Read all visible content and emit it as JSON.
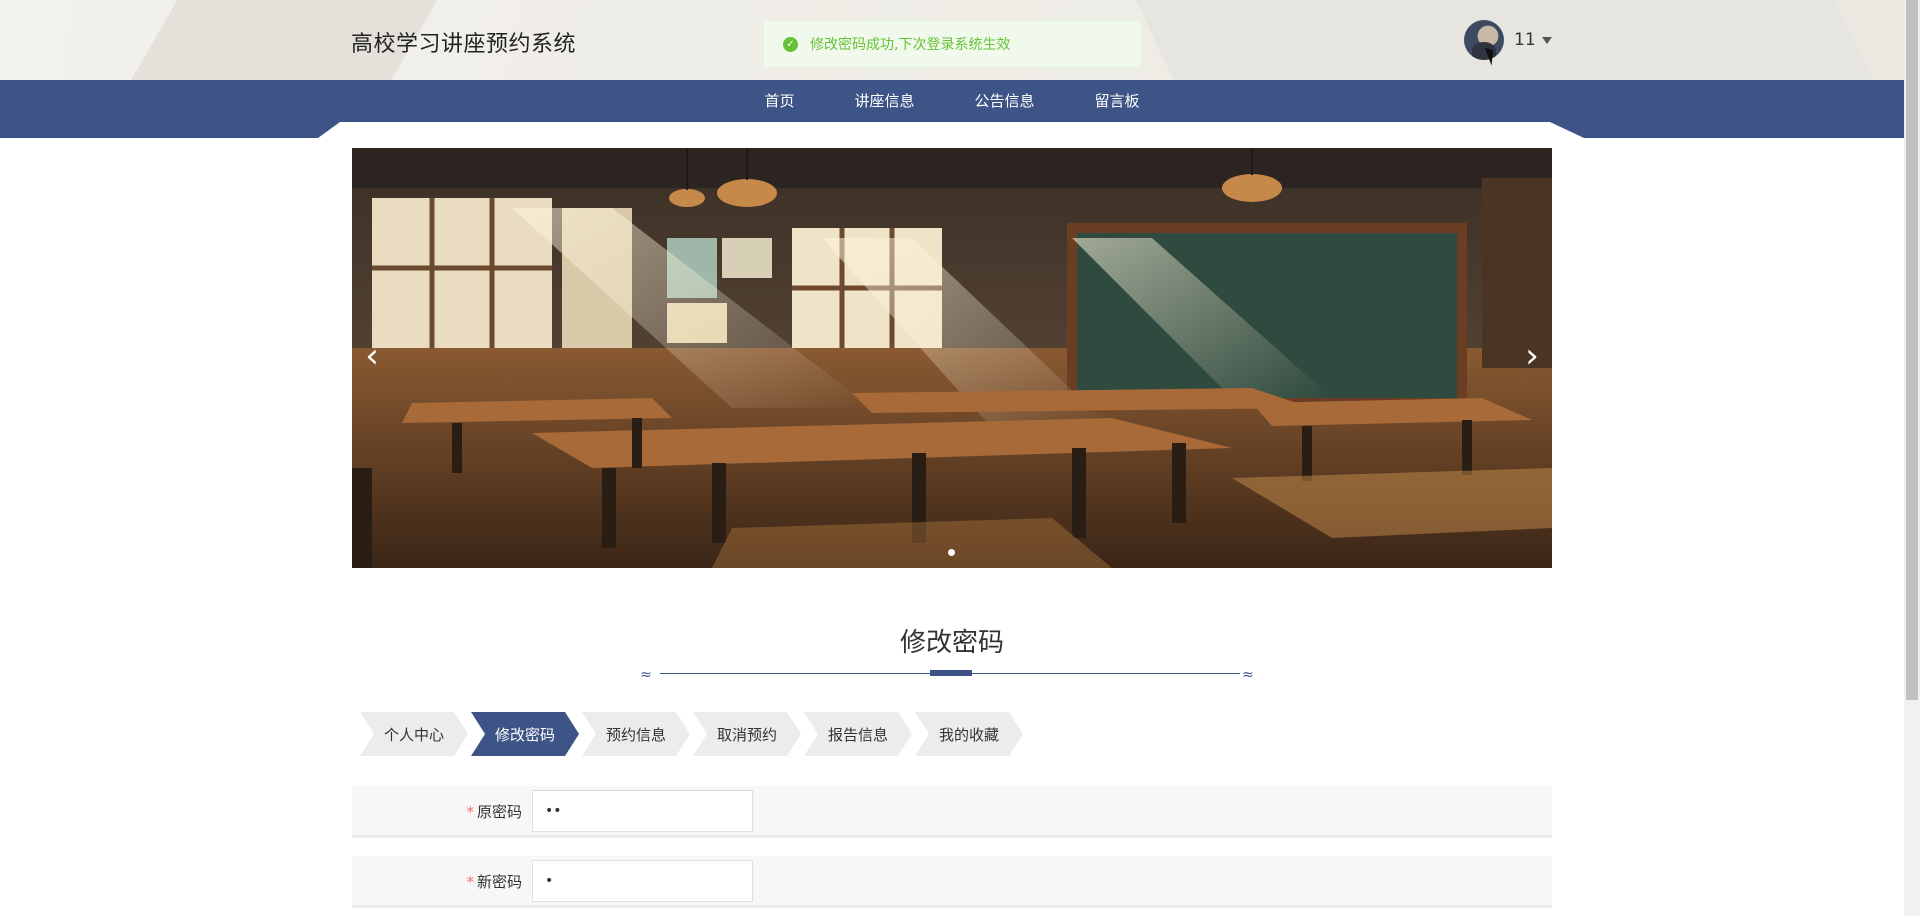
{
  "header": {
    "site_title": "高校学习讲座预约系统",
    "toast_message": "修改密码成功,下次登录系统生效",
    "user_name": "11"
  },
  "nav": {
    "items": [
      "首页",
      "讲座信息",
      "公告信息",
      "留言板"
    ]
  },
  "carousel": {
    "prev_icon": "‹",
    "next_icon": "›",
    "slide_count": 1,
    "active_index": 0
  },
  "section": {
    "title": "修改密码"
  },
  "tabs": {
    "items": [
      "个人中心",
      "修改密码",
      "预约信息",
      "取消预约",
      "报告信息",
      "我的收藏"
    ],
    "active_index": 1
  },
  "form": {
    "fields": [
      {
        "required_mark": "*",
        "label": "原密码",
        "value": "••"
      },
      {
        "required_mark": "*",
        "label": "新密码",
        "value": "•"
      }
    ]
  },
  "icons": {
    "toast": "check-circle-icon",
    "user_menu": "caret-down-icon"
  },
  "colors": {
    "primary": "#3e5487",
    "success": "#67c23a",
    "required": "#f56c6c"
  }
}
